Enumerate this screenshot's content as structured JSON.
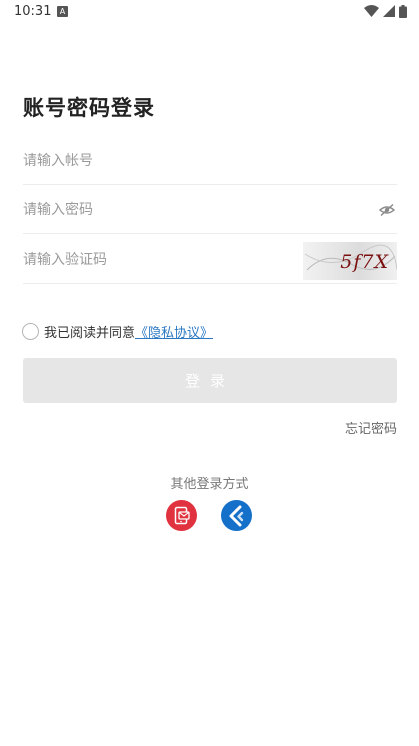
{
  "status_bar": {
    "time": "10:31",
    "notification_letter": "A",
    "icons": [
      "wifi-icon",
      "signal-icon",
      "battery-icon"
    ]
  },
  "page": {
    "title": "账号密码登录"
  },
  "form": {
    "account_placeholder": "请输入帐号",
    "password_placeholder": "请输入密码",
    "captcha_placeholder": "请输入验证码",
    "captcha_image_text": "5f7X"
  },
  "agreement": {
    "text": "我已阅读并同意",
    "link": "《隐私协议》",
    "checked": false
  },
  "actions": {
    "login_label": "登录",
    "forgot_label": "忘记密码"
  },
  "other_login": {
    "label": "其他登录方式",
    "methods": [
      "sms-login-icon",
      "app-login-icon"
    ]
  },
  "colors": {
    "link": "#2b78c2",
    "login_button_disabled": "#e6e6e6",
    "sms_icon": "#e0323f",
    "app_icon": "#1570c9"
  }
}
